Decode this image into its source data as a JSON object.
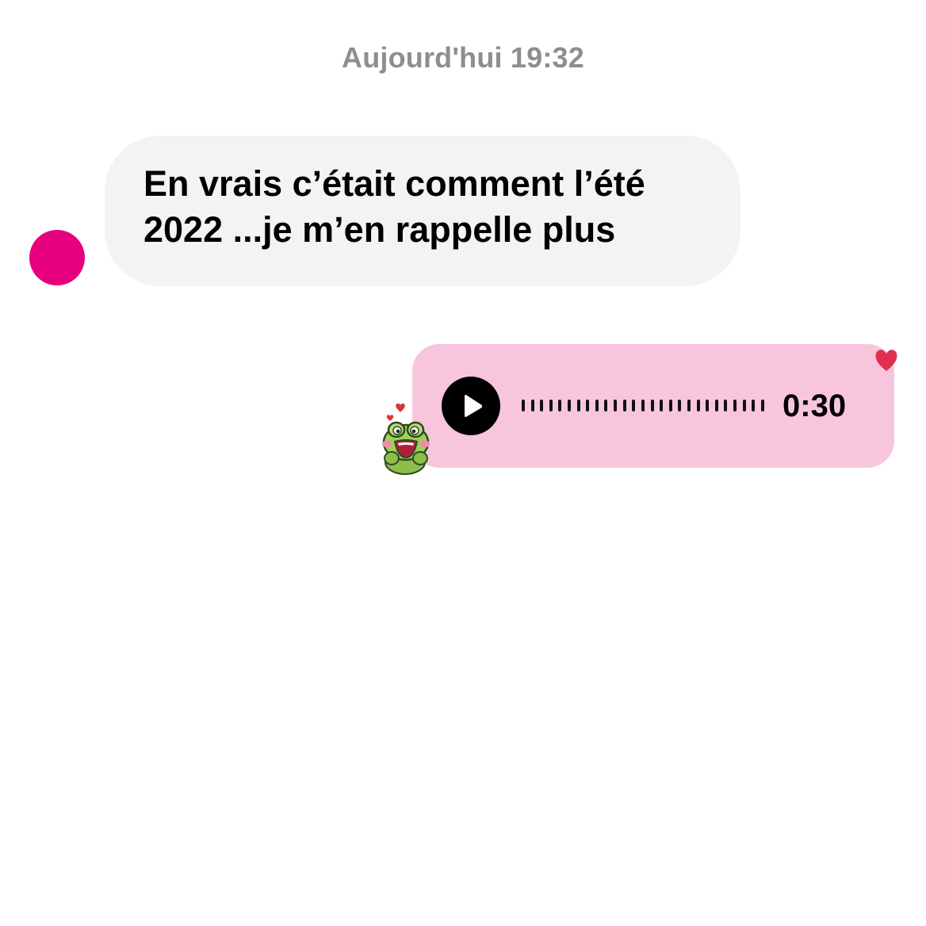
{
  "chat": {
    "timestamp": "Aujourd'hui 19:32"
  },
  "incoming_message": {
    "text": "En vrais c’était comment l’été 2022 ...je m’en rappelle plus",
    "avatar_color": "#e6007e",
    "bubble_color": "#f3f3f3"
  },
  "outgoing_voice_message": {
    "duration": "0:30",
    "bubble_color": "#f7c6dc",
    "icon": "play-icon",
    "reaction_icon": "heart-icon",
    "reaction_color": "#e0304e",
    "sticker_icon": "frog-sticker-icon"
  }
}
